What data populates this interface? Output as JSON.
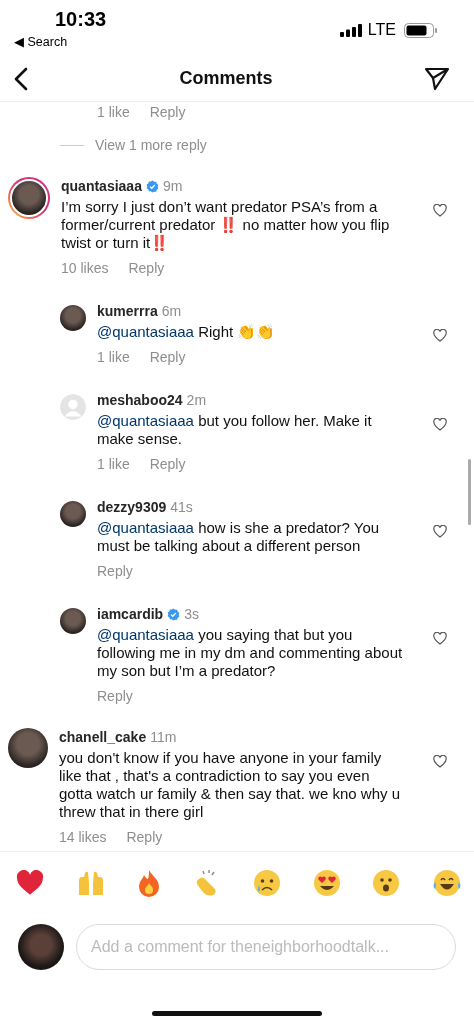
{
  "status_bar": {
    "time": "10:33",
    "back_label": "◀ Search",
    "network": "LTE"
  },
  "header": {
    "title": "Comments"
  },
  "cut_meta": {
    "likes": "1 like",
    "reply": "Reply"
  },
  "view_more": {
    "label": "View 1 more reply"
  },
  "comments": [
    {
      "kind": "comment",
      "default_avatar": false,
      "story_ring": true,
      "username": "quantasiaaa",
      "verified": true,
      "time": "9m",
      "text": "I’m sorry I just don’t want predator PSA’s from a former/current predator ‼️ no matter how you flip twist or turn it‼️",
      "likes": "10 likes",
      "reply": "Reply"
    },
    {
      "kind": "reply",
      "default_avatar": false,
      "story_ring": false,
      "username": "kumerrra",
      "verified": false,
      "time": "6m",
      "mention": "@quantasiaaa",
      "text": " Right 👏👏",
      "likes": "1 like",
      "reply": "Reply"
    },
    {
      "kind": "reply",
      "default_avatar": true,
      "story_ring": false,
      "username": "meshaboo24",
      "verified": false,
      "time": "2m",
      "mention": "@quantasiaaa",
      "text": " but you follow her. Make it make sense.",
      "likes": "1 like",
      "reply": "Reply"
    },
    {
      "kind": "reply",
      "default_avatar": false,
      "story_ring": false,
      "username": "dezzy9309",
      "verified": false,
      "time": "41s",
      "mention": "@quantasiaaa",
      "text": " how is she a predator? You must be talking about a different person",
      "reply": "Reply"
    },
    {
      "kind": "reply",
      "default_avatar": false,
      "story_ring": false,
      "username": "iamcardib",
      "verified": true,
      "time": "3s",
      "mention": "@quantasiaaa",
      "text": " you saying that but you following me in my dm and commenting about my son but I’m a predator?",
      "reply": "Reply"
    },
    {
      "kind": "comment",
      "default_avatar": false,
      "story_ring": false,
      "username": "chanell_cake",
      "verified": false,
      "time": "11m",
      "text": "you don't know if you have anyone in your family like that , that's a contradiction to say you even gotta watch ur family & then say that. we kno why u threw that in there girl",
      "likes": "14 likes",
      "reply": "Reply"
    }
  ],
  "composer": {
    "placeholder": "Add a comment for theneighborhoodtalk..."
  }
}
